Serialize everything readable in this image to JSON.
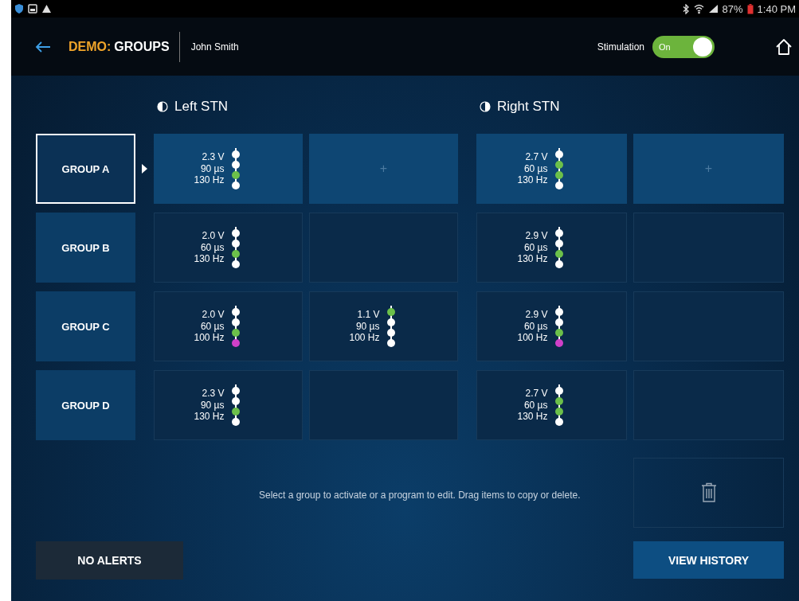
{
  "status_bar": {
    "battery": "87%",
    "time": "1:40 PM"
  },
  "header": {
    "title_prefix": "DEMO:",
    "title": "GROUPS",
    "patient": "John Smith",
    "stimulation": {
      "label": "Stimulation",
      "toggle": {
        "label": "On",
        "on": true
      }
    }
  },
  "hemispheres": [
    {
      "label": "Left STN",
      "kind": "left"
    },
    {
      "label": "Right STN",
      "kind": "right"
    }
  ],
  "groups": [
    {
      "name": "GROUP A",
      "selected": true,
      "programs": [
        {
          "kind": "program",
          "amplitude": "2.3 V",
          "pulse_width": "90 µs",
          "rate": "130 Hz",
          "contacts": [
            {
              "color": "#ffffff"
            },
            {
              "color": "#ffffff"
            },
            {
              "color": "#6cc04a"
            },
            {
              "color": "#ffffff"
            }
          ]
        },
        {
          "kind": "add",
          "label": "+"
        },
        {
          "kind": "program",
          "amplitude": "2.7 V",
          "pulse_width": "60 µs",
          "rate": "130 Hz",
          "contacts": [
            {
              "color": "#ffffff"
            },
            {
              "color": "#6cc04a"
            },
            {
              "color": "#6cc04a"
            },
            {
              "color": "#ffffff"
            }
          ]
        },
        {
          "kind": "add",
          "label": "+"
        }
      ]
    },
    {
      "name": "GROUP B",
      "selected": false,
      "programs": [
        {
          "kind": "program",
          "amplitude": "2.0 V",
          "pulse_width": "60 µs",
          "rate": "130 Hz",
          "contacts": [
            {
              "color": "#ffffff"
            },
            {
              "color": "#ffffff"
            },
            {
              "color": "#6cc04a"
            },
            {
              "color": "#ffffff"
            }
          ]
        },
        {
          "kind": "empty"
        },
        {
          "kind": "program",
          "amplitude": "2.9 V",
          "pulse_width": "60 µs",
          "rate": "130 Hz",
          "contacts": [
            {
              "color": "#ffffff"
            },
            {
              "color": "#ffffff"
            },
            {
              "color": "#6cc04a"
            },
            {
              "color": "#ffffff"
            }
          ]
        },
        {
          "kind": "empty"
        }
      ]
    },
    {
      "name": "GROUP C",
      "selected": false,
      "programs": [
        {
          "kind": "program",
          "amplitude": "2.0 V",
          "pulse_width": "60 µs",
          "rate": "100 Hz",
          "contacts": [
            {
              "color": "#ffffff"
            },
            {
              "color": "#ffffff"
            },
            {
              "color": "#6cc04a"
            },
            {
              "color": "#d040c8"
            }
          ]
        },
        {
          "kind": "program",
          "amplitude": "1.1 V",
          "pulse_width": "90 µs",
          "rate": "100 Hz",
          "contacts": [
            {
              "color": "#6cc04a"
            },
            {
              "color": "#ffffff"
            },
            {
              "color": "#ffffff"
            },
            {
              "color": "#ffffff"
            }
          ]
        },
        {
          "kind": "program",
          "amplitude": "2.9 V",
          "pulse_width": "60 µs",
          "rate": "100 Hz",
          "contacts": [
            {
              "color": "#ffffff"
            },
            {
              "color": "#ffffff"
            },
            {
              "color": "#6cc04a"
            },
            {
              "color": "#d040c8"
            }
          ]
        },
        {
          "kind": "empty"
        }
      ]
    },
    {
      "name": "GROUP D",
      "selected": false,
      "programs": [
        {
          "kind": "program",
          "amplitude": "2.3 V",
          "pulse_width": "90 µs",
          "rate": "130 Hz",
          "contacts": [
            {
              "color": "#ffffff"
            },
            {
              "color": "#ffffff"
            },
            {
              "color": "#6cc04a"
            },
            {
              "color": "#ffffff"
            }
          ]
        },
        {
          "kind": "empty"
        },
        {
          "kind": "program",
          "amplitude": "2.7 V",
          "pulse_width": "60 µs",
          "rate": "130 Hz",
          "contacts": [
            {
              "color": "#ffffff"
            },
            {
              "color": "#6cc04a"
            },
            {
              "color": "#6cc04a"
            },
            {
              "color": "#ffffff"
            }
          ]
        },
        {
          "kind": "empty"
        }
      ]
    }
  ],
  "hint": "Select a group to activate or a program to edit. Drag items to copy or delete.",
  "buttons": {
    "alerts": "NO ALERTS",
    "history": "VIEW HISTORY"
  }
}
